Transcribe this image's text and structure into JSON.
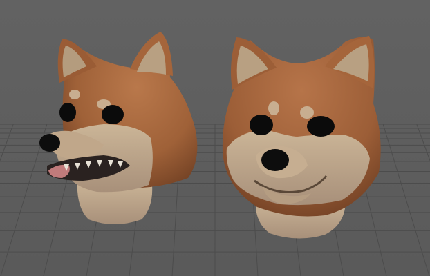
{
  "viewport": {
    "content": [
      "dog-head-open-mouth",
      "dog-head-closed-mouth"
    ],
    "grid": true,
    "colors": {
      "background": "#5d5d5d",
      "grid_line": "#4a4a4a",
      "fur_orange": "#a5673f",
      "fur_cream": "#c2ab8e",
      "ear_inner": "#b39a7c",
      "eye": "#0b0b0b",
      "nose": "#0d0d0d",
      "tongue": "#c17b7b"
    }
  }
}
